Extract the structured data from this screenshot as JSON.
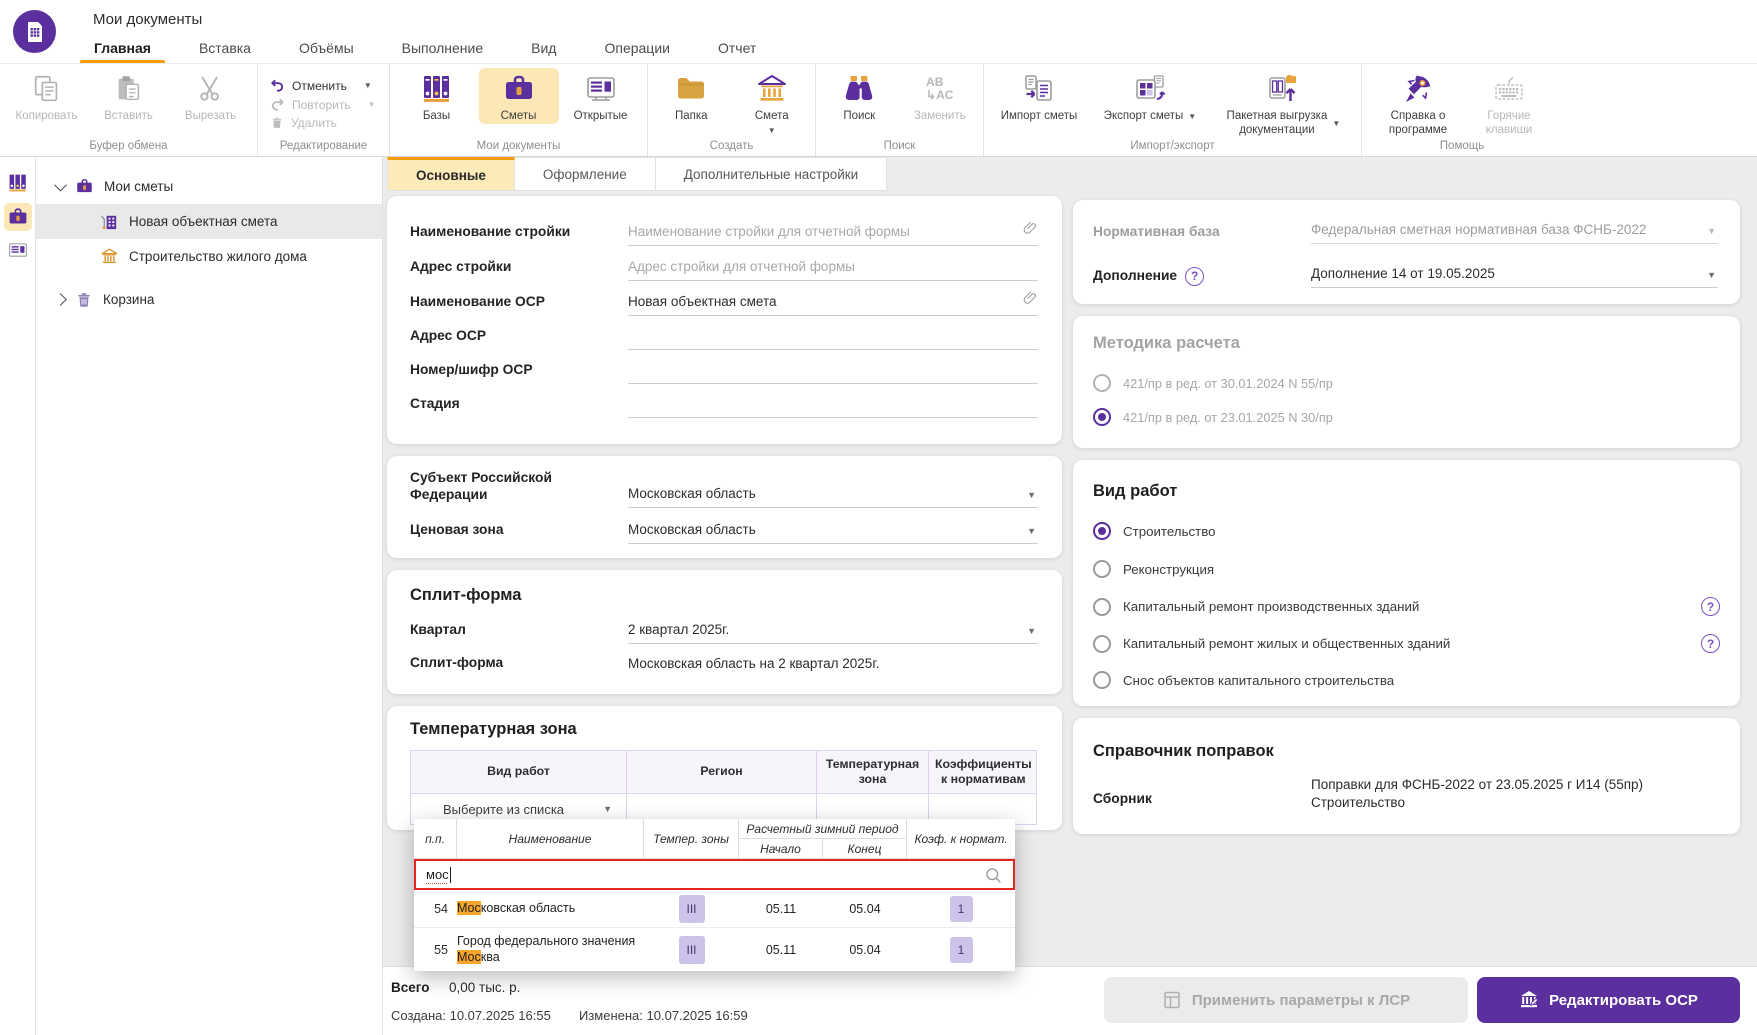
{
  "app": {
    "title": "Мои документы"
  },
  "menu": {
    "tabs": [
      {
        "label": "Главная"
      },
      {
        "label": "Вставка"
      },
      {
        "label": "Объёмы"
      },
      {
        "label": "Выполнение"
      },
      {
        "label": "Вид"
      },
      {
        "label": "Операции"
      },
      {
        "label": "Отчет"
      }
    ]
  },
  "ribbon": {
    "copy": "Копировать",
    "paste": "Вставить",
    "cut": "Вырезать",
    "undo": "Отменить",
    "redo": "Повторить",
    "del": "Удалить",
    "bases": "Базы",
    "estimates": "Сметы",
    "opened": "Открытые",
    "folder": "Папка",
    "estimate": "Смета",
    "search": "Поиск",
    "replace": "Заменить",
    "replace_glyph_top": "AB",
    "replace_glyph_bottom": "↳AC",
    "import": "Импорт сметы",
    "export": "Экспорт сметы",
    "batch1": "Пакетная выгрузка",
    "batch2": "документации",
    "help1": "Справка о",
    "help2": "программе",
    "keys1": "Горячие",
    "keys2": "клавиши",
    "caps": {
      "clipboard": "Буфер обмена",
      "editing": "Редактирование",
      "docs": "Мои документы",
      "create": "Создать",
      "search": "Поиск",
      "impexp": "Импорт/экспорт",
      "help": "Помощь"
    }
  },
  "tree": {
    "root": "Мои сметы",
    "items": [
      {
        "label": "Новая объектная смета"
      },
      {
        "label": "Строительство жилого дома"
      }
    ],
    "trash": "Корзина"
  },
  "tabs": [
    {
      "label": "Основные"
    },
    {
      "label": "Оформление"
    },
    {
      "label": "Дополнительные настройки"
    }
  ],
  "form": {
    "rows": [
      {
        "label": "Наименование стройки",
        "placeholder": "Наименование стройки для отчетной формы",
        "value": ""
      },
      {
        "label": "Адрес стройки",
        "placeholder": "Адрес стройки для отчетной формы",
        "value": ""
      },
      {
        "label": "Наименование ОСР",
        "placeholder": "",
        "value": "Новая объектная смета"
      },
      {
        "label": "Адрес ОСР",
        "placeholder": "",
        "value": ""
      },
      {
        "label": "Номер/шифр ОСР",
        "placeholder": "",
        "value": ""
      },
      {
        "label": "Стадия",
        "placeholder": "",
        "value": ""
      }
    ]
  },
  "region": {
    "subject_label": "Субъект Российской Федерации",
    "subject_value": "Московская область",
    "zone_label": "Ценовая зона",
    "zone_value": "Московская область"
  },
  "split": {
    "title": "Сплит-форма",
    "quarter_label": "Квартал",
    "quarter_value": "2 квартал 2025г.",
    "form_label": "Сплит-форма",
    "form_value": "Московская область на 2 квартал 2025г."
  },
  "temp_zone": {
    "title": "Температурная зона",
    "col_work": "Вид работ",
    "col_region": "Регион",
    "col_zone": "Температурная зона",
    "col_coef": "Коэффициенты к нормативам",
    "select_placeholder": "Выберите из списка"
  },
  "popup": {
    "col_num": "п.п.",
    "col_name": "Наименование",
    "col_zone": "Темпер. зоны",
    "col_period": "Расчетный зимний период",
    "col_start": "Начало",
    "col_end": "Конец",
    "col_coef": "Коэф. к нормат.",
    "search_value": "мос",
    "rows": [
      {
        "num": "54",
        "name_pre": "",
        "name_hl": "Мос",
        "name_rest": "ковская область",
        "zone": "III",
        "start": "05.11",
        "end": "05.04",
        "coef": "1"
      },
      {
        "num": "55",
        "name_pre": "Город федерального значения ",
        "name_hl": "Мос",
        "name_rest": "ква",
        "zone": "III",
        "start": "05.11",
        "end": "05.04",
        "coef": "1"
      }
    ]
  },
  "norm": {
    "base_label": "Нормативная база",
    "base_value": "Федеральная сметная нормативная база ФСНБ-2022",
    "supplement_label": "Дополнение",
    "supplement_value": "Дополнение 14 от 19.05.2025"
  },
  "method": {
    "title": "Методика расчета",
    "options": [
      {
        "label": "421/пр в ред. от 30.01.2024 N 55/пр"
      },
      {
        "label": "421/пр в ред. от 23.01.2025 N 30/пр"
      }
    ]
  },
  "work": {
    "title": "Вид работ",
    "options": [
      {
        "label": "Строительство"
      },
      {
        "label": "Реконструкция"
      },
      {
        "label": "Капитальный ремонт производственных зданий"
      },
      {
        "label": "Капитальный ремонт жилых и общественных зданий"
      },
      {
        "label": "Снос объектов капитального строительства"
      }
    ]
  },
  "corrections": {
    "title": "Справочник поправок",
    "label": "Сборник",
    "line1": "Поправки для ФСНБ-2022 от 23.05.2025 г И14 (55пр)",
    "line2": "Строительство"
  },
  "status": {
    "total_label": "Всего",
    "total_value": "0,00 тыс. р.",
    "created": "Создана: 10.07.2025 16:55",
    "modified": "Изменена: 10.07.2025 16:59",
    "apply": "Применить параметры к ЛСР",
    "edit": "Редактировать ОСР"
  }
}
